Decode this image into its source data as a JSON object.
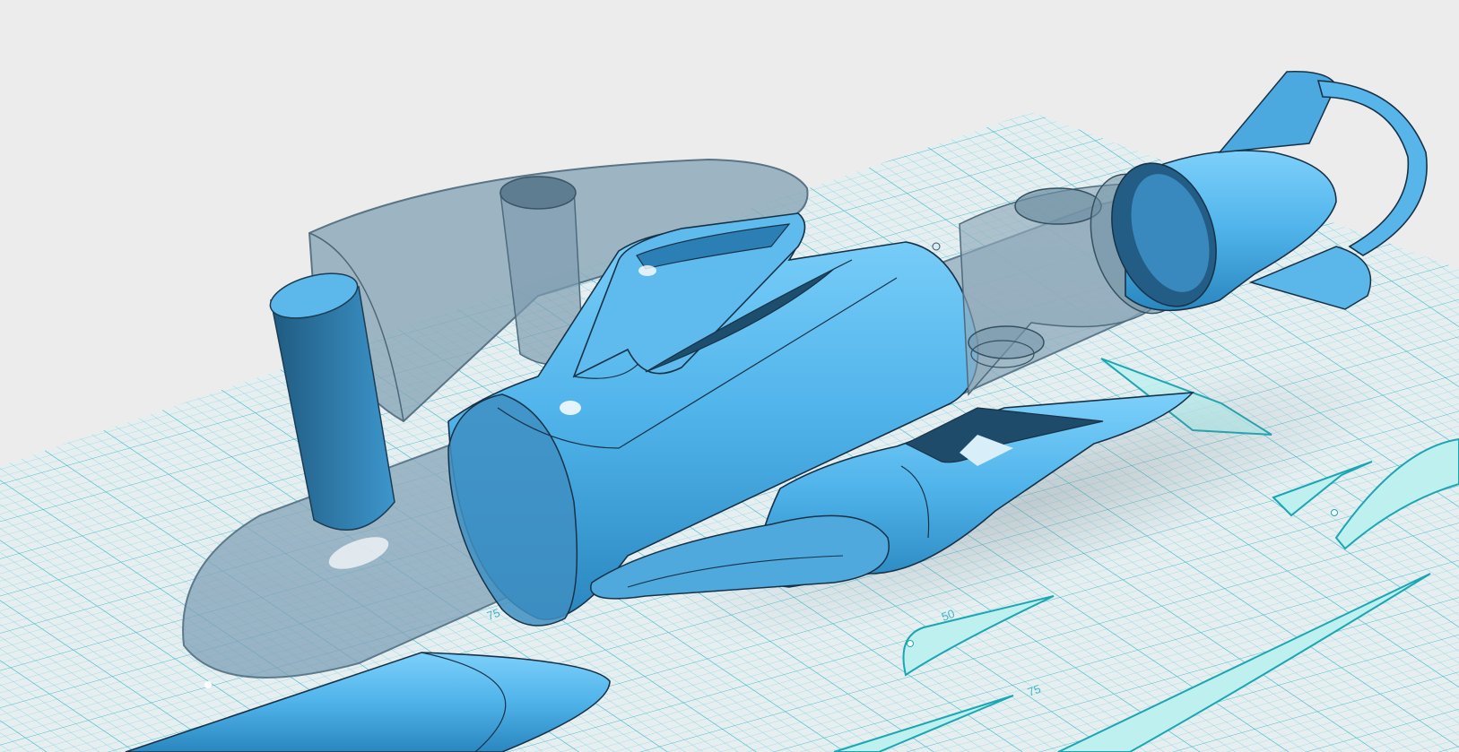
{
  "viewport": {
    "background": "#ececec",
    "grid_color": "#4fc3d6",
    "grid_major_color": "#2db2c8",
    "model_color": "#56b6ea",
    "model_shadow_color": "#1f6d96",
    "ghost_color": "#8fb0c4",
    "sketch_fill": "#b8efee",
    "sketch_stroke": "#1aa6b3"
  },
  "sketch_labels": {
    "label_75_left": "75",
    "label_50": "50",
    "label_75": "75"
  }
}
